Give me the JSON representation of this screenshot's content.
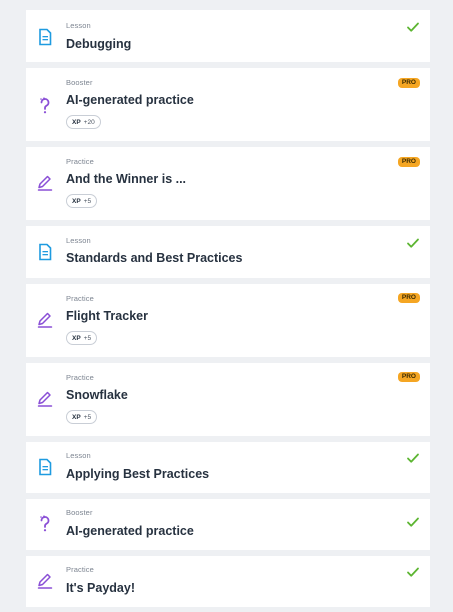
{
  "colors": {
    "lesson_icon": "#1e9be0",
    "practice_icon": "#8a4fd6",
    "booster_icon": "#8a4fd6",
    "check": "#5cb531",
    "pro_badge": "#f5a623"
  },
  "items": [
    {
      "kind": "Lesson",
      "title": "Debugging",
      "icon": "lesson-icon",
      "status": "completed"
    },
    {
      "kind": "Booster",
      "title": "AI-generated practice",
      "icon": "question-icon",
      "pro": "PRO",
      "xp_label": "XP",
      "xp_value": "+20"
    },
    {
      "kind": "Practice",
      "title": "And the Winner is ...",
      "icon": "edit-icon",
      "pro": "PRO",
      "xp_label": "XP",
      "xp_value": "+5"
    },
    {
      "kind": "Lesson",
      "title": "Standards and Best Practices",
      "icon": "lesson-icon",
      "status": "completed"
    },
    {
      "kind": "Practice",
      "title": "Flight Tracker",
      "icon": "edit-icon",
      "pro": "PRO",
      "xp_label": "XP",
      "xp_value": "+5"
    },
    {
      "kind": "Practice",
      "title": "Snowflake",
      "icon": "edit-icon",
      "pro": "PRO",
      "xp_label": "XP",
      "xp_value": "+5"
    },
    {
      "kind": "Lesson",
      "title": "Applying Best Practices",
      "icon": "lesson-icon",
      "status": "completed"
    },
    {
      "kind": "Booster",
      "title": "AI-generated practice",
      "icon": "question-icon",
      "status": "completed"
    },
    {
      "kind": "Practice",
      "title": "It's Payday!",
      "icon": "edit-icon",
      "status": "completed"
    }
  ]
}
